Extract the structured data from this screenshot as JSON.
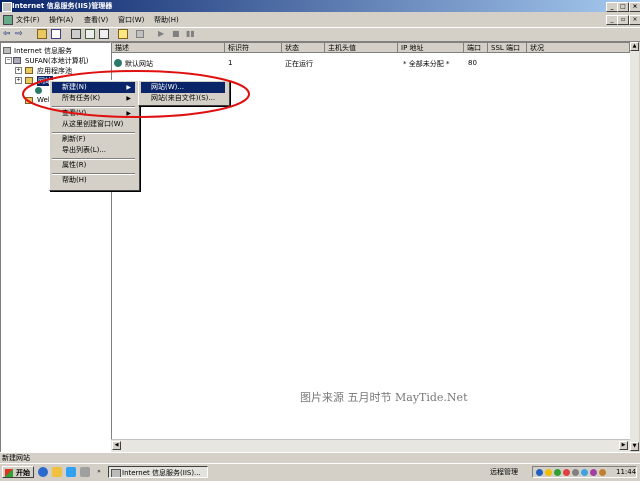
{
  "window": {
    "title": "Internet 信息服务(IIS)管理器"
  },
  "menubar": [
    {
      "label": "文件(F)"
    },
    {
      "label": "操作(A)"
    },
    {
      "label": "查看(V)"
    },
    {
      "label": "窗口(W)"
    },
    {
      "label": "帮助(H)"
    }
  ],
  "tree": {
    "root": "Internet 信息服务",
    "computer": "SUFAN(本地计算机)",
    "app_pools": "应用程序池",
    "websites": "网站",
    "web_ext": "Web"
  },
  "list": {
    "columns": [
      "描述",
      "标识符",
      "状态",
      "主机头值",
      "IP 地址",
      "端口",
      "SSL 端口",
      "状况"
    ],
    "rows": [
      {
        "desc": "默认网站",
        "id": "1",
        "state": "正在运行",
        "host": "",
        "ip": "* 全部未分配 *",
        "port": "80",
        "ssl": "",
        "status": ""
      }
    ]
  },
  "context_menu": {
    "items": [
      {
        "label": "新建(N)",
        "submenu": true,
        "selected": true
      },
      {
        "label": "所有任务(K)",
        "submenu": true
      },
      {
        "label": "查看(V)",
        "submenu": true
      },
      {
        "label": "从这里创建窗口(W)"
      },
      {
        "label": "刷新(F)"
      },
      {
        "label": "导出列表(L)..."
      },
      {
        "label": "属性(R)"
      },
      {
        "label": "帮助(H)"
      }
    ],
    "submenu": [
      {
        "label": "网站(W)...",
        "selected": true
      },
      {
        "label": "网站(来自文件)(S)..."
      }
    ]
  },
  "statusbar": {
    "text": "新建网站"
  },
  "taskbar": {
    "start": "开始",
    "task": "Internet 信息服务(IIS)...",
    "tray_label": "远程管理",
    "clock": "11:44"
  },
  "watermark": "图片来源 五月时节 MayTide.Net",
  "colors": {
    "selection": "#0a246a",
    "highlight_ring": "#e01010",
    "title_start": "#0a246a",
    "title_end": "#a6caf0"
  }
}
